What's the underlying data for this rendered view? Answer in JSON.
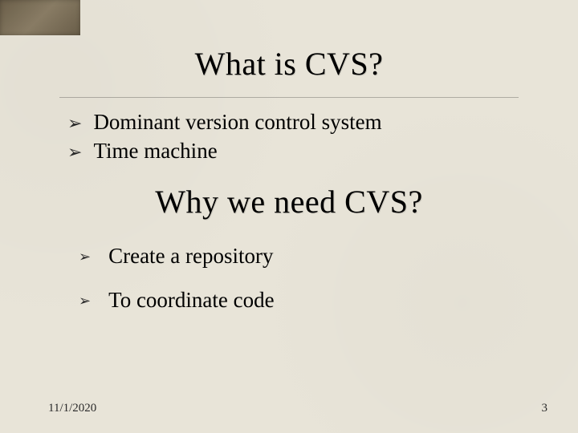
{
  "section1": {
    "heading": "What is CVS?",
    "bullets": [
      "Dominant version control system",
      "Time machine"
    ]
  },
  "section2": {
    "heading": "Why we need CVS?",
    "bullets": [
      "Create a repository",
      "To coordinate code"
    ]
  },
  "footer": {
    "date": "11/1/2020",
    "page": "3"
  }
}
